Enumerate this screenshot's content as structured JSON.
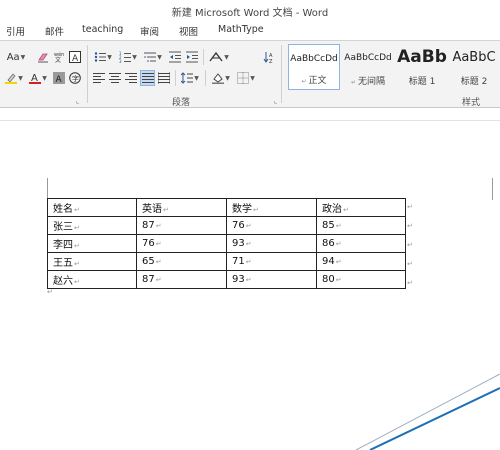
{
  "window": {
    "title": "新建 Microsoft Word 文档 - Word"
  },
  "tabs": [
    "引用",
    "邮件",
    "teaching",
    "审阅",
    "视图",
    "MathType"
  ],
  "ribbon": {
    "font_size_label": "Aa",
    "groups": {
      "paragraph": "段落",
      "styles": "样式"
    },
    "styles": [
      {
        "sample": "AaBbCcDd",
        "name": "正文"
      },
      {
        "sample": "AaBbCcDd",
        "name": "无间隔"
      },
      {
        "sample": "AaBb",
        "name": "标题 1"
      },
      {
        "sample": "AaBbC",
        "name": "标题 2"
      }
    ],
    "icons": [
      "change-case-icon",
      "clear-format-icon",
      "phonetic-icon",
      "char-border-icon",
      "highlight-icon",
      "font-color-icon",
      "char-shading-icon",
      "enclose-char-icon",
      "bullets-icon",
      "numbering-icon",
      "multilevel-list-icon",
      "decrease-indent-icon",
      "increase-indent-icon",
      "chinese-layout-icon",
      "sort-icon",
      "align-left-icon",
      "center-icon",
      "align-right-icon",
      "justify-icon",
      "distributed-icon",
      "line-spacing-icon",
      "shading-icon",
      "borders-icon"
    ],
    "colors": {
      "highlight": "#f2d600",
      "font_color": "#d02020",
      "selected_style_border": "#8fb4e3"
    }
  },
  "table": {
    "headers": [
      "姓名",
      "英语",
      "数学",
      "政治"
    ],
    "rows": [
      [
        "张三",
        "87",
        "76",
        "85"
      ],
      [
        "李四",
        "76",
        "93",
        "86"
      ],
      [
        "王五",
        "65",
        "71",
        "94"
      ],
      [
        "赵六",
        "87",
        "93",
        "80"
      ]
    ]
  }
}
